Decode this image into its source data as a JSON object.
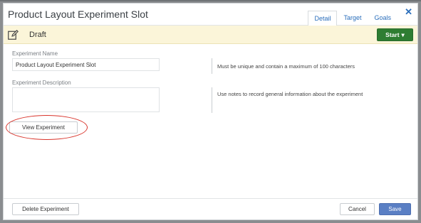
{
  "modal": {
    "title": "Product Layout Experiment Slot",
    "tabs": [
      {
        "label": "Detail",
        "active": true
      },
      {
        "label": "Target",
        "active": false
      },
      {
        "label": "Goals",
        "active": false
      }
    ],
    "close_glyph": "✕"
  },
  "status": {
    "icon": "edit-icon",
    "label": "Draft",
    "start_button": "Start",
    "start_caret": "▾",
    "accent": "#2e7d32",
    "background": "#fbf5d9"
  },
  "form": {
    "name": {
      "label": "Experiment Name",
      "value": "Product Layout Experiment Slot",
      "help": "Must be unique and contain a maximum of 100 characters"
    },
    "description": {
      "label": "Experiment Description",
      "value": "",
      "help": "Use notes to record general information about the experiment"
    },
    "view_button": "View Experiment"
  },
  "footer": {
    "delete_button": "Delete Experiment",
    "cancel_button": "Cancel",
    "save_button": "Save"
  }
}
